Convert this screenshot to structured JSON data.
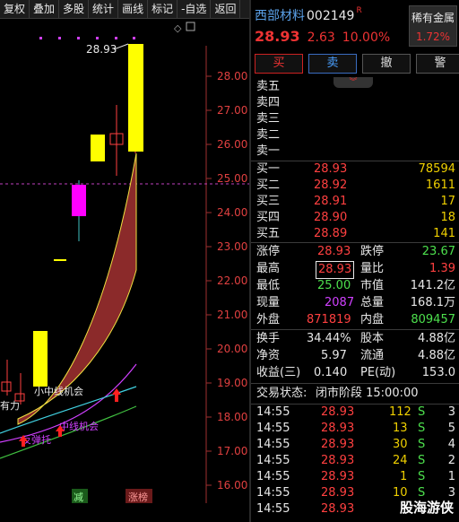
{
  "toolbar": [
    "复权",
    "叠加",
    "多股",
    "统计",
    "画线",
    "标记",
    "-自选",
    "返回"
  ],
  "chart": {
    "y_ticks": [
      "28.00",
      "27.00",
      "26.00",
      "25.00",
      "24.00",
      "23.00",
      "22.00",
      "21.00",
      "20.00",
      "19.00",
      "18.00",
      "17.00",
      "16.00"
    ],
    "peak_label": "28.93",
    "annotations": [
      "小中线机会",
      "中线机会",
      "反弹托",
      "有力"
    ],
    "bottom_tags": [
      "减",
      "涨榜"
    ]
  },
  "header": {
    "name": "西部材料",
    "code": "002149",
    "r_mark": "R"
  },
  "sector": {
    "name": "稀有金属",
    "pct": "1.72%"
  },
  "quote": {
    "price": "28.93",
    "change": "2.63",
    "pct": "10.00%"
  },
  "buttons": {
    "buy": "买",
    "sell": "卖",
    "cancel": "撤",
    "alert": "警"
  },
  "sells": [
    "卖五",
    "卖四",
    "卖三",
    "卖二",
    "卖一"
  ],
  "buys": [
    {
      "label": "买一",
      "price": "28.93",
      "vol": "78594"
    },
    {
      "label": "买二",
      "price": "28.92",
      "vol": "1611"
    },
    {
      "label": "买三",
      "price": "28.91",
      "vol": "17"
    },
    {
      "label": "买四",
      "price": "28.90",
      "vol": "18"
    },
    {
      "label": "买五",
      "price": "28.89",
      "vol": "141"
    }
  ],
  "stats": [
    {
      "l1": "涨停",
      "v1": "28.93",
      "l2": "跌停",
      "v2": "23.67"
    },
    {
      "l1": "最高",
      "v1": "28.93",
      "l2": "量比",
      "v2": "1.39"
    },
    {
      "l1": "最低",
      "v1": "25.00",
      "l2": "市值",
      "v2": "141.2亿"
    },
    {
      "l1": "现量",
      "v1": "2087",
      "l2": "总量",
      "v2": "168.1万"
    },
    {
      "l1": "外盘",
      "v1": "871819",
      "l2": "内盘",
      "v2": "809457"
    }
  ],
  "stats2": [
    {
      "l1": "换手",
      "v1": "34.44%",
      "l2": "股本",
      "v2": "4.88亿"
    },
    {
      "l1": "净资",
      "v1": "5.97",
      "l2": "流通",
      "v2": "4.88亿"
    },
    {
      "l1": "收益(三)",
      "v1": "0.140",
      "l2": "PE(动)",
      "v2": "153.0"
    }
  ],
  "status": {
    "label": "交易状态:",
    "value": "闭市阶段 15:00:00"
  },
  "ticks": [
    {
      "t": "14:55",
      "p": "28.93",
      "v": "112",
      "s": "S",
      "n": "3"
    },
    {
      "t": "14:55",
      "p": "28.93",
      "v": "13",
      "s": "S",
      "n": "5"
    },
    {
      "t": "14:55",
      "p": "28.93",
      "v": "30",
      "s": "S",
      "n": "4"
    },
    {
      "t": "14:55",
      "p": "28.93",
      "v": "24",
      "s": "S",
      "n": "2"
    },
    {
      "t": "14:55",
      "p": "28.93",
      "v": "1",
      "s": "S",
      "n": "1"
    },
    {
      "t": "14:55",
      "p": "28.93",
      "v": "10",
      "s": "S",
      "n": "3"
    },
    {
      "t": "14:55",
      "p": "28.93",
      "v": "",
      "s": "",
      "n": ""
    }
  ],
  "watermark": "股海游侠",
  "colors": {
    "up": "#ff4040",
    "down": "#4de04d",
    "bg": "#000000",
    "candle_up": "#ffff00",
    "candle_down": "#ff00ff",
    "band": "#8b2a2a"
  }
}
